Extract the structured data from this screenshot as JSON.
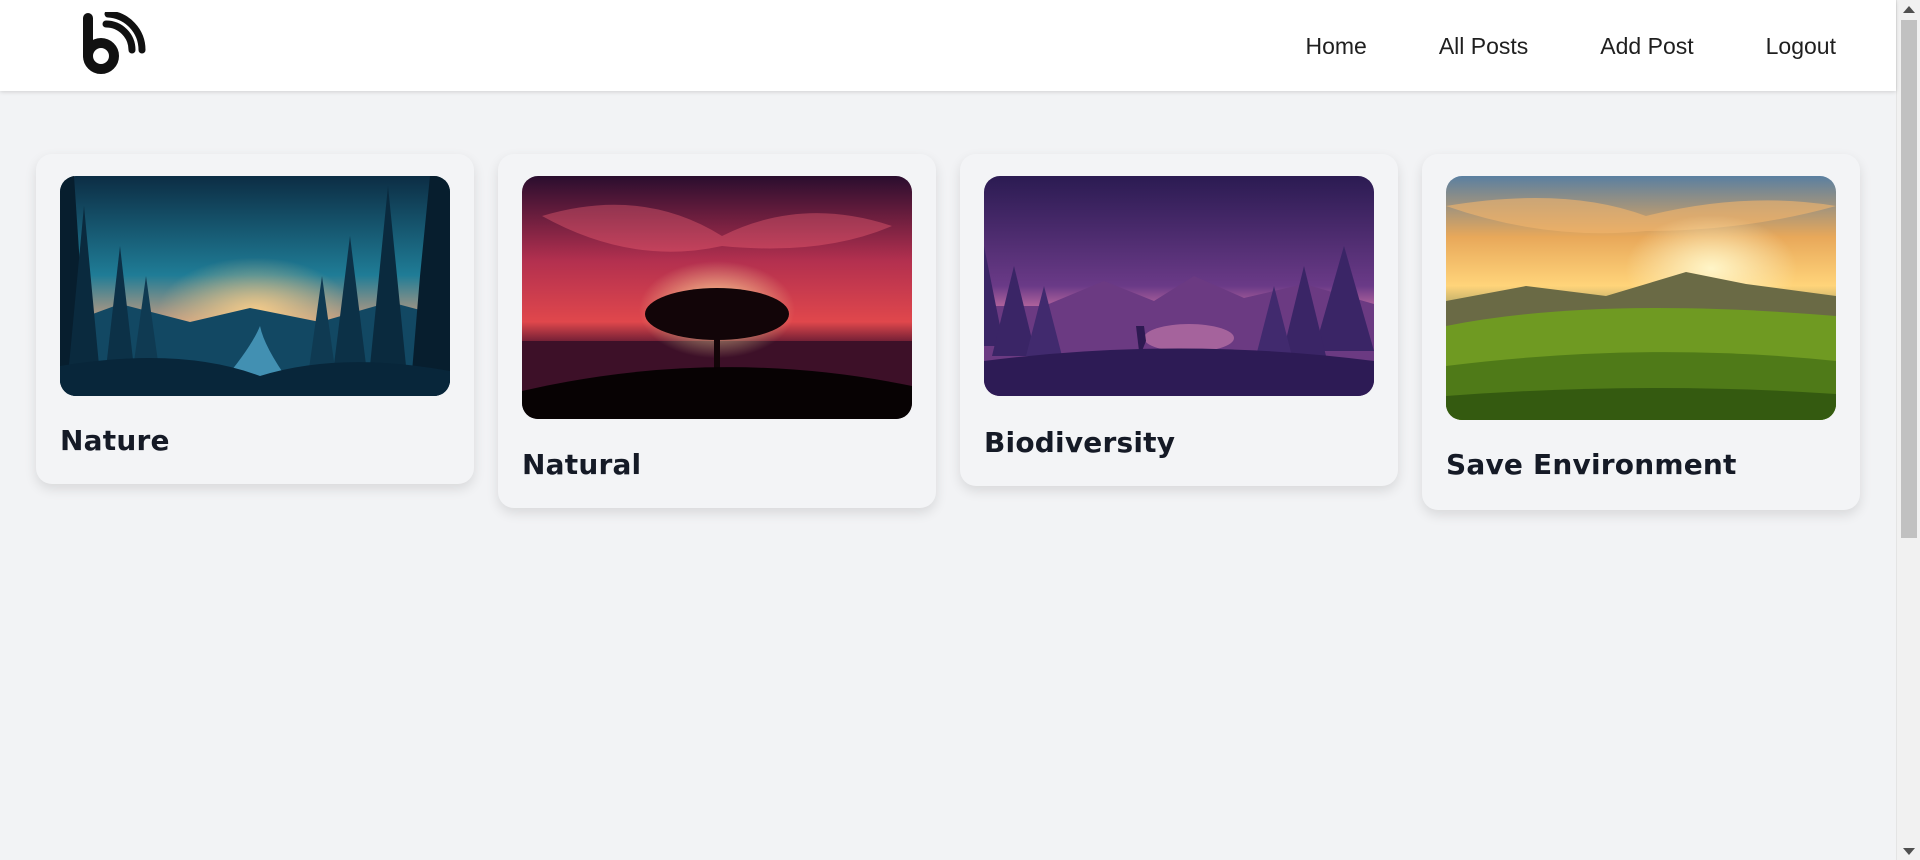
{
  "header": {
    "logo_icon": "blog-rss-logo-icon",
    "nav": [
      "Home",
      "All Posts",
      "Add Post",
      "Logout"
    ]
  },
  "posts": [
    {
      "title": "Nature",
      "image": "forest-river-sunset-illustration"
    },
    {
      "title": "Natural",
      "image": "lone-tree-red-sky-sea"
    },
    {
      "title": "Biodiversity",
      "image": "purple-lake-deer-mountains"
    },
    {
      "title": "Save Environment",
      "image": "green-meadow-golden-sunset-mountains"
    }
  ],
  "colors": {
    "page_background": "#f2f3f5",
    "header_background": "#ffffff",
    "card_background": "#f3f4f6",
    "title_text": "#151a26"
  }
}
